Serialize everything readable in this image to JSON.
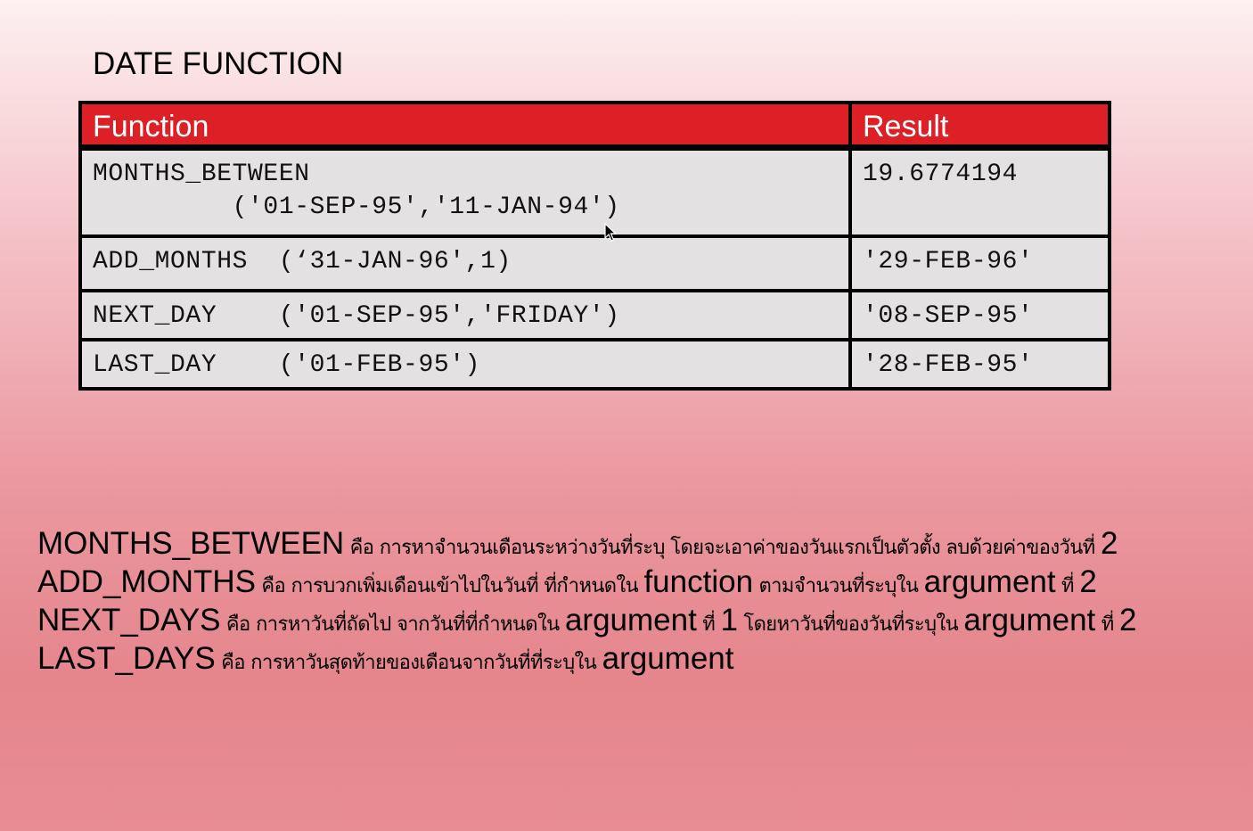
{
  "slide": {
    "title": "DATE FUNCTION"
  },
  "table": {
    "headers": {
      "function": "Function",
      "result": "Result"
    },
    "rows": [
      {
        "function_lines": [
          "MONTHS_BETWEEN",
          "         ('01-SEP-95','11-JAN-94')"
        ],
        "result": "19.6774194"
      },
      {
        "function_lines": [
          "ADD_MONTHS  (‘31-JAN-96',1)"
        ],
        "result": "'29-FEB-96'"
      },
      {
        "function_lines": [
          "NEXT_DAY    ('01-SEP-95','FRIDAY')"
        ],
        "result": "'08-SEP-95'"
      },
      {
        "function_lines": [
          "LAST_DAY    ('01-FEB-95')"
        ],
        "result": "'28-FEB-95'"
      }
    ]
  },
  "notes": [
    [
      {
        "t": "MONTHS_BETWEEN",
        "k": true
      },
      {
        "t": " คือ การหาจำนวนเดือนระหว่างวันที่ระบุ โดยจะเอาค่าของวันแรกเป็นตัวตั้ง ลบด้วยค่าของวันที่ ",
        "k": false
      },
      {
        "t": "2",
        "k": true
      }
    ],
    [
      {
        "t": "ADD_MONTHS",
        "k": true
      },
      {
        "t": " คือ การบวกเพิ่มเดือนเข้าไปในวันที่ ที่กำหนดใน ",
        "k": false
      },
      {
        "t": "function",
        "k": true
      },
      {
        "t": " ตามจำนวนที่ระบุใน ",
        "k": false
      },
      {
        "t": "argument",
        "k": true
      },
      {
        "t": " ที่ ",
        "k": false
      },
      {
        "t": "2",
        "k": true
      }
    ],
    [
      {
        "t": "NEXT_DAYS",
        "k": true
      },
      {
        "t": " คือ การหาวันที่ถัดไป จากวันที่ที่กำหนดใน ",
        "k": false
      },
      {
        "t": "argument",
        "k": true
      },
      {
        "t": " ที่ ",
        "k": false
      },
      {
        "t": "1",
        "k": true
      },
      {
        "t": " โดยหาวันที่ของวันที่ระบุใน ",
        "k": false
      },
      {
        "t": "argument",
        "k": true
      },
      {
        "t": " ที่ ",
        "k": false
      },
      {
        "t": "2",
        "k": true
      }
    ],
    [
      {
        "t": "LAST_DAYS",
        "k": true
      },
      {
        "t": " คือ การหาวันสุดท้ายของเดือนจากวันที่ที่ระบุใน ",
        "k": false
      },
      {
        "t": "argument",
        "k": true
      }
    ]
  ],
  "icons": {
    "cursor": "mouse-pointer-arrow"
  }
}
